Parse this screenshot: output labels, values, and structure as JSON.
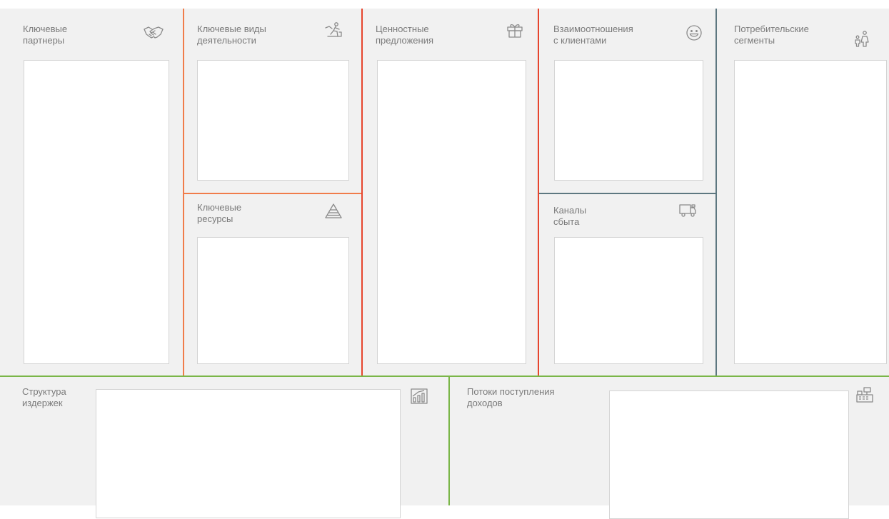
{
  "canvas": {
    "key_partners": {
      "title": "Ключевые\nпартнеры",
      "icon": "handshake-icon"
    },
    "key_activities": {
      "title": "Ключевые виды\nдеятельности",
      "icon": "worker-icon"
    },
    "key_resources": {
      "title": "Ключевые\nресурсы",
      "icon": "pyramid-icon"
    },
    "value_propositions": {
      "title": "Ценностные\nпредложения",
      "icon": "gift-icon"
    },
    "customer_relationships": {
      "title": "Взаимоотношения\nс клиентами",
      "icon": "smiley-icon"
    },
    "channels": {
      "title": "Каналы\nсбыта",
      "icon": "truck-icon"
    },
    "customer_segments": {
      "title": "Потребительские\nсегменты",
      "icon": "people-icon"
    },
    "cost_structure": {
      "title": "Структура\nиздержек",
      "icon": "chart-icon"
    },
    "revenue_streams": {
      "title": "Потоки поступления\nдоходов",
      "icon": "cash-register-icon"
    }
  },
  "colors": {
    "background": "#f1f1f1",
    "box": "#ffffff",
    "text": "#7a7a7a",
    "divider_orange": "#f07c4a",
    "divider_red": "#e6452d",
    "divider_slate": "#5d7780",
    "divider_green": "#7ab648"
  }
}
